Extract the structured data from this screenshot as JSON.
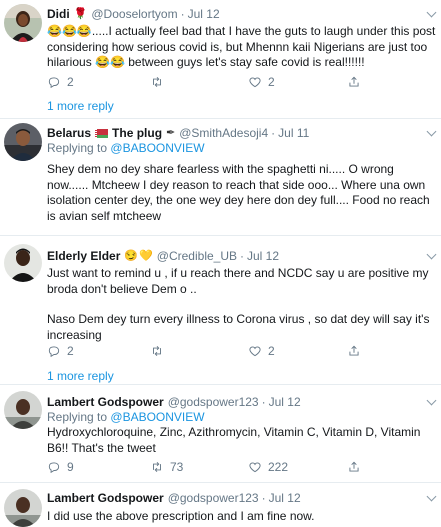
{
  "tweets": [
    {
      "name": "Didi",
      "handle": "@Dooselortyom",
      "time": "Jul 12",
      "body": [
        "😂😂😂.....I actually feel bad that I have the guts to laugh under this post considering how serious covid is, but Mhennn  kaii Nigerians are just too hilarious 😂😂 between guys let's stay safe covid is real!!!!!!"
      ],
      "replies": "2",
      "retweets": "",
      "likes": "2",
      "more": "1 more reply"
    },
    {
      "name": "Belarus",
      "name_suffix": "The plug",
      "handle": "@SmithAdesoji4",
      "time": "Jul 11",
      "reply_prefix": "Replying to",
      "reply_to": "@BABOONVIEW",
      "body": [
        "Shey dem no dey share fearless with the spaghetti ni..... O wrong now...... Mtcheew I dey reason to reach that side ooo... Where una own isolation center dey, the one wey dey here don dey full.... Food no reach is avian self mtcheew"
      ],
      "replies": "",
      "retweets": "",
      "likes": ""
    },
    {
      "name": "Elderly Elder",
      "handle": "@Credible_UB",
      "time": "Jul 12",
      "body": [
        "Just want to remind u , if u reach there and NCDC say u are positive my broda don't believe Dem o ..",
        "Naso Dem dey turn every illness to Corona virus , so dat dey will say it's increasing"
      ],
      "replies": "2",
      "retweets": "",
      "likes": "2",
      "more": "1 more reply"
    },
    {
      "name": "Lambert Godspower",
      "handle": "@godspower123",
      "time": "Jul 12",
      "reply_prefix": "Replying to",
      "reply_to": "@BABOONVIEW",
      "body": [
        "Hydroxychloroquine, Zinc, Azithromycin, Vitamin C, Vitamin D, Vitamin B6!! That's the tweet"
      ],
      "replies": "9",
      "retweets": "73",
      "likes": "222"
    },
    {
      "name": "Lambert Godspower",
      "handle": "@godspower123",
      "time": "Jul 12",
      "body": [
        "I did use the above prescription and I am fine now."
      ]
    }
  ],
  "icons": {
    "reply": "reply-icon",
    "retweet": "retweet-icon",
    "like": "heart-icon",
    "share": "share-icon",
    "caret": "chevron-down-icon"
  },
  "colors": {
    "link": "#1b95e0",
    "secondary_text": "#657786",
    "divider": "#e6ecf0"
  }
}
